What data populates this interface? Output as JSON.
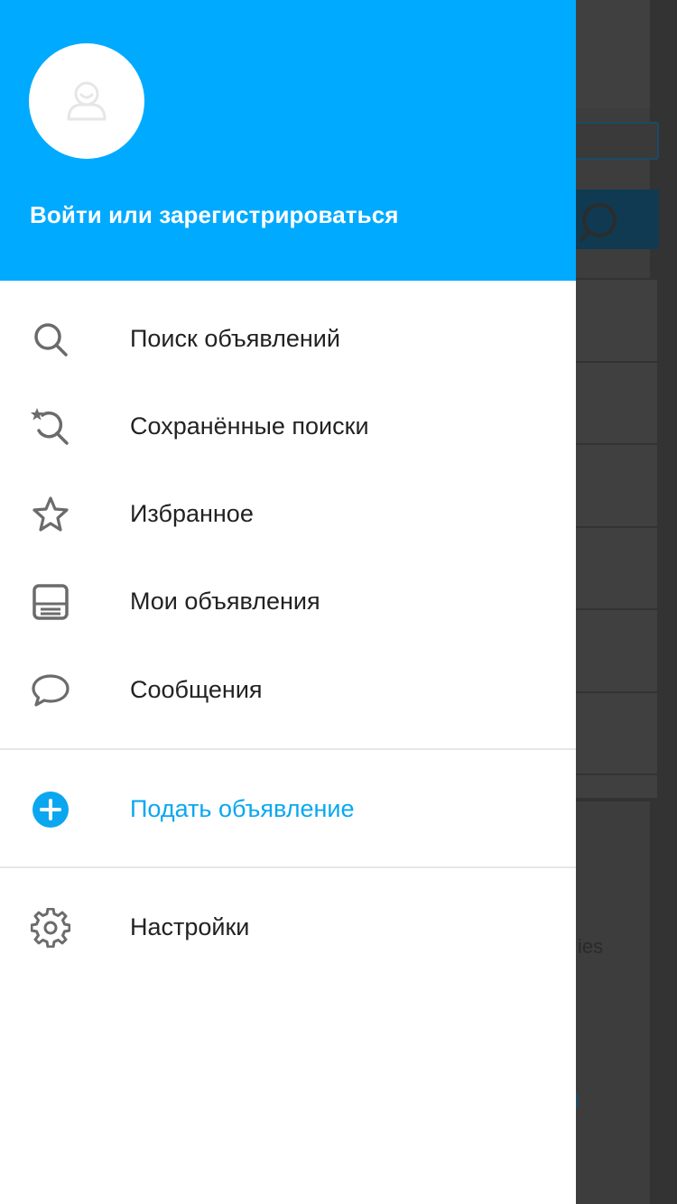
{
  "header": {
    "login_text": "Войти или зарегистрироваться",
    "accent_color": "#00aaff"
  },
  "menu": {
    "items": [
      {
        "label": "Поиск объявлений",
        "icon": "search-icon"
      },
      {
        "label": "Сохранённые поиски",
        "icon": "saved-search-icon"
      },
      {
        "label": "Избранное",
        "icon": "star-icon"
      },
      {
        "label": "Мои объявления",
        "icon": "my-listings-icon"
      },
      {
        "label": "Сообщения",
        "icon": "chat-icon"
      }
    ],
    "post_ad": {
      "label": "Подать объявление",
      "icon": "plus-circle-icon",
      "color": "#0aa7f0"
    },
    "settings": {
      "label": "Настройки",
      "icon": "gear-icon"
    }
  },
  "background": {
    "partial_text": "ies"
  }
}
